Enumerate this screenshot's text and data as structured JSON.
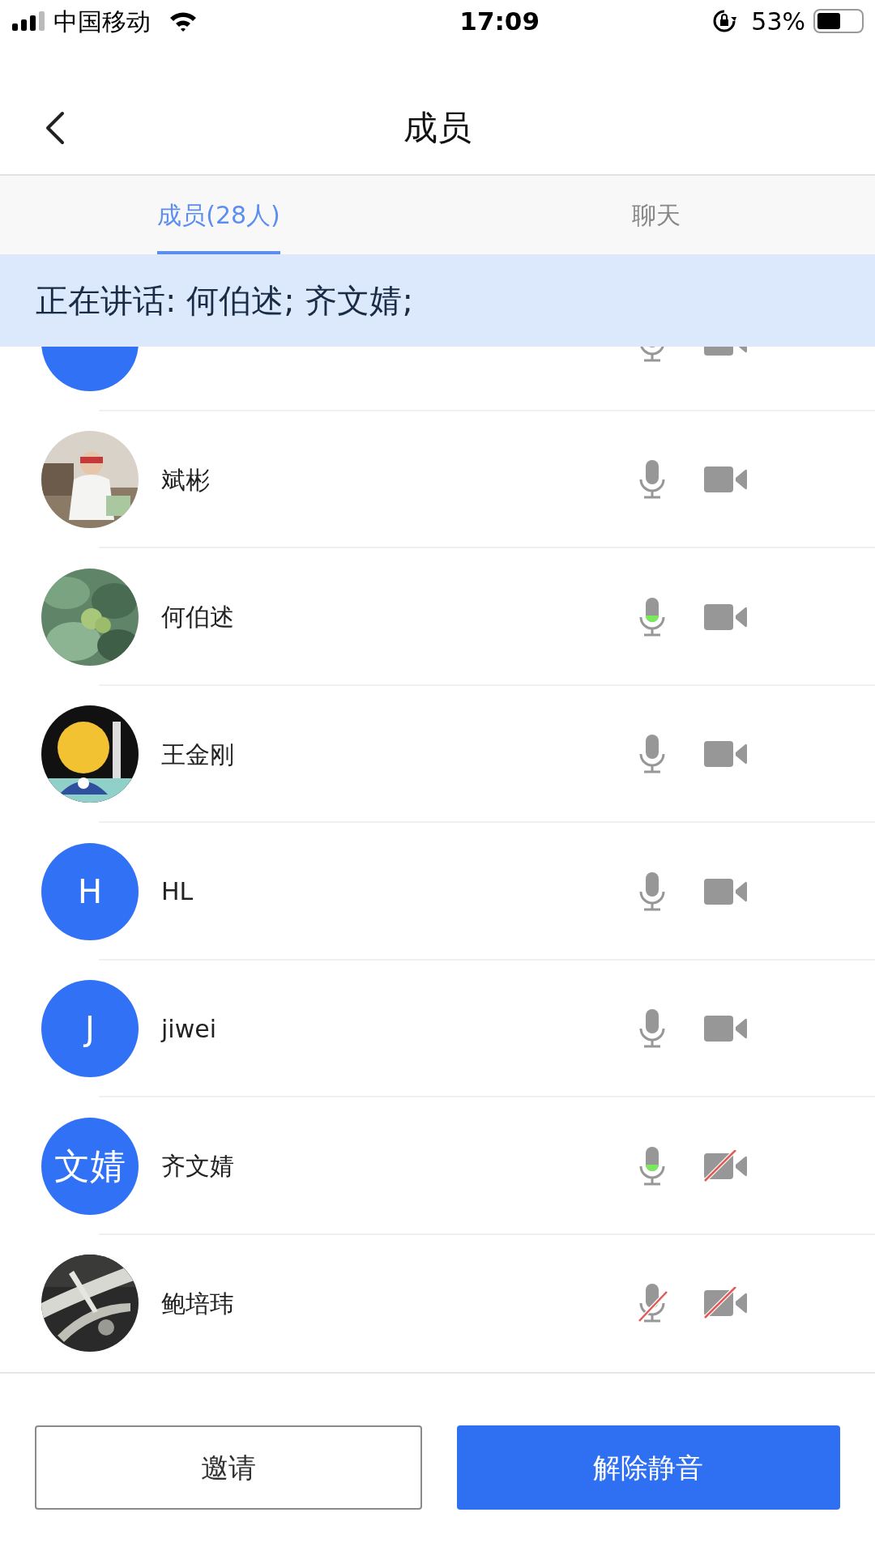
{
  "status_bar": {
    "carrier": "中国移动",
    "time": "17:09",
    "battery": "53%"
  },
  "nav": {
    "title": "成员"
  },
  "tabs": [
    {
      "label": "成员(28人)",
      "selected": true
    },
    {
      "label": "聊天",
      "selected": false
    }
  ],
  "speaking_banner": "正在讲话: 何伯述; 齐文婧;",
  "members": [
    {
      "avatar": {
        "kind": "initials"
      },
      "speaking": false,
      "muted": false,
      "camera_on": true
    },
    {
      "name": "斌彬",
      "speaking": false,
      "muted": false,
      "camera_on": true
    },
    {
      "name": "何伯述",
      "speaking": true,
      "muted": false,
      "camera_on": true
    },
    {
      "name": "王金刚",
      "speaking": false,
      "muted": false,
      "camera_on": true
    },
    {
      "avatar": {
        "kind": "initials",
        "text": "H"
      },
      "name": "HL",
      "speaking": false,
      "muted": false,
      "camera_on": true
    },
    {
      "avatar": {
        "kind": "initials",
        "text": "J"
      },
      "name": "jiwei",
      "speaking": false,
      "muted": false,
      "camera_on": true
    },
    {
      "avatar": {
        "kind": "initials",
        "text": "文婧"
      },
      "name": "齐文婧",
      "speaking": true,
      "muted": false,
      "camera_on": false
    },
    {
      "name": "鲍培玮",
      "speaking": false,
      "muted": true,
      "camera_on": false
    }
  ],
  "buttons": [
    {
      "label": "邀请",
      "kind": "outline"
    },
    {
      "label": "解除静音",
      "kind": "primary"
    }
  ]
}
